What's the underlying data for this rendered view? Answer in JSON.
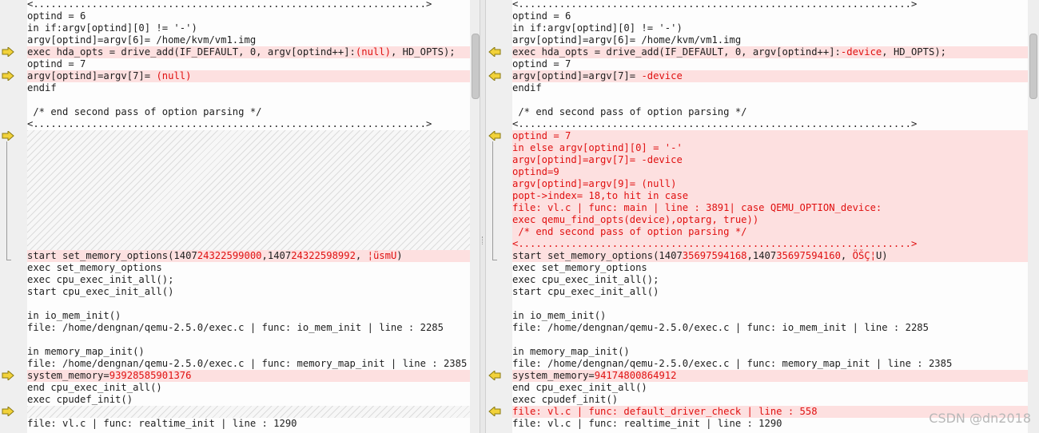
{
  "left_lines": [
    {
      "segs": [
        [
          "<...................................................................>",
          ""
        ]
      ],
      "state": "normal"
    },
    {
      "segs": [
        [
          "optind = 6",
          ""
        ]
      ],
      "state": "normal"
    },
    {
      "segs": [
        [
          "in if:argv[optind][0] != '-')",
          ""
        ]
      ],
      "state": "normal"
    },
    {
      "segs": [
        [
          "argv[optind]=argv[6]= /home/kvm/vm1.img",
          ""
        ]
      ],
      "state": "normal"
    },
    {
      "segs": [
        [
          "exec hda_opts = drive_add(IF_DEFAULT, 0, argv[optind++]:",
          ""
        ],
        [
          "(null)",
          "red"
        ],
        [
          ", HD_OPTS);",
          ""
        ]
      ],
      "state": "changed"
    },
    {
      "segs": [
        [
          "optind = 7",
          ""
        ]
      ],
      "state": "normal"
    },
    {
      "segs": [
        [
          "argv[optind]=argv[7]= ",
          ""
        ],
        [
          "(null)",
          "red"
        ]
      ],
      "state": "changed"
    },
    {
      "segs": [
        [
          "endif",
          ""
        ]
      ],
      "state": "normal"
    },
    {
      "segs": [
        [
          "",
          ""
        ]
      ],
      "state": "normal"
    },
    {
      "segs": [
        [
          " /* end second pass of option parsing */",
          ""
        ]
      ],
      "state": "normal"
    },
    {
      "segs": [
        [
          "<...................................................................>",
          ""
        ]
      ],
      "state": "normal"
    },
    {
      "segs": [],
      "state": "hatch"
    },
    {
      "segs": [],
      "state": "hatch"
    },
    {
      "segs": [],
      "state": "hatch"
    },
    {
      "segs": [],
      "state": "hatch"
    },
    {
      "segs": [],
      "state": "hatch"
    },
    {
      "segs": [],
      "state": "hatch"
    },
    {
      "segs": [],
      "state": "hatch"
    },
    {
      "segs": [],
      "state": "hatch"
    },
    {
      "segs": [],
      "state": "hatch"
    },
    {
      "segs": [],
      "state": "hatch"
    },
    {
      "segs": [
        [
          "start set_memory_options(1407",
          ""
        ],
        [
          "24322599000",
          "red"
        ],
        [
          ",1407",
          ""
        ],
        [
          "24322598992",
          "red"
        ],
        [
          ", ",
          ""
        ],
        [
          "¦üsmU",
          "red"
        ],
        [
          ")",
          ""
        ]
      ],
      "state": "changed"
    },
    {
      "segs": [
        [
          "exec set_memory_options",
          ""
        ]
      ],
      "state": "normal"
    },
    {
      "segs": [
        [
          "exec cpu_exec_init_all();",
          ""
        ]
      ],
      "state": "normal"
    },
    {
      "segs": [
        [
          "start cpu_exec_init_all()",
          ""
        ]
      ],
      "state": "normal"
    },
    {
      "segs": [
        [
          "",
          ""
        ]
      ],
      "state": "normal"
    },
    {
      "segs": [
        [
          "in io_mem_init()",
          ""
        ]
      ],
      "state": "normal"
    },
    {
      "segs": [
        [
          "file: /home/dengnan/qemu-2.5.0/exec.c | func: io_mem_init | line : 2285",
          ""
        ]
      ],
      "state": "normal"
    },
    {
      "segs": [
        [
          "",
          ""
        ]
      ],
      "state": "normal"
    },
    {
      "segs": [
        [
          "in memory_map_init()",
          ""
        ]
      ],
      "state": "normal"
    },
    {
      "segs": [
        [
          "file: /home/dengnan/qemu-2.5.0/exec.c | func: memory_map_init | line : 2385",
          ""
        ]
      ],
      "state": "normal"
    },
    {
      "segs": [
        [
          "system_memory=",
          ""
        ],
        [
          "93928585901376",
          "red"
        ]
      ],
      "state": "changed"
    },
    {
      "segs": [
        [
          "end cpu_exec_init_all()",
          ""
        ]
      ],
      "state": "normal"
    },
    {
      "segs": [
        [
          "exec cpudef_init()",
          ""
        ]
      ],
      "state": "normal"
    },
    {
      "segs": [],
      "state": "hatch"
    },
    {
      "segs": [
        [
          "file: vl.c | func: realtime_init | line : 1290",
          ""
        ]
      ],
      "state": "normal"
    }
  ],
  "right_lines": [
    {
      "segs": [
        [
          "<...................................................................>",
          ""
        ]
      ],
      "state": "normal"
    },
    {
      "segs": [
        [
          "optind = 6",
          ""
        ]
      ],
      "state": "normal"
    },
    {
      "segs": [
        [
          "in if:argv[optind][0] != '-')",
          ""
        ]
      ],
      "state": "normal"
    },
    {
      "segs": [
        [
          "argv[optind]=argv[6]= /home/kvm/vm1.img",
          ""
        ]
      ],
      "state": "normal"
    },
    {
      "segs": [
        [
          "exec hda_opts = drive_add(IF_DEFAULT, 0, argv[optind++]:",
          ""
        ],
        [
          "-device",
          "red"
        ],
        [
          ", HD_OPTS);",
          ""
        ]
      ],
      "state": "changed"
    },
    {
      "segs": [
        [
          "optind = 7",
          ""
        ]
      ],
      "state": "normal"
    },
    {
      "segs": [
        [
          "argv[optind]=argv[7]= ",
          ""
        ],
        [
          "-device",
          "red"
        ]
      ],
      "state": "changed"
    },
    {
      "segs": [
        [
          "endif",
          ""
        ]
      ],
      "state": "normal"
    },
    {
      "segs": [
        [
          "",
          ""
        ]
      ],
      "state": "normal"
    },
    {
      "segs": [
        [
          " /* end second pass of option parsing */",
          ""
        ]
      ],
      "state": "normal"
    },
    {
      "segs": [
        [
          "<...................................................................>",
          ""
        ]
      ],
      "state": "normal"
    },
    {
      "segs": [
        [
          "optind = 7",
          "red"
        ]
      ],
      "state": "changed"
    },
    {
      "segs": [
        [
          "in else argv[optind][0] = '-'",
          "red"
        ]
      ],
      "state": "changed"
    },
    {
      "segs": [
        [
          "argv[optind]=argv[7]= -device",
          "red"
        ]
      ],
      "state": "changed"
    },
    {
      "segs": [
        [
          "optind=9",
          "red"
        ]
      ],
      "state": "changed"
    },
    {
      "segs": [
        [
          "argv[optind]=argv[9]= (null)",
          "red"
        ]
      ],
      "state": "changed"
    },
    {
      "segs": [
        [
          "popt->index= 18,to hit in case",
          "red"
        ]
      ],
      "state": "changed"
    },
    {
      "segs": [
        [
          "file: vl.c | func: main | line : 3891| case QEMU_OPTION_device:",
          "red"
        ]
      ],
      "state": "changed"
    },
    {
      "segs": [
        [
          "exec qemu_find_opts(device),optarg, true))",
          "red"
        ]
      ],
      "state": "changed"
    },
    {
      "segs": [
        [
          " /* end second pass of option parsing */",
          "red"
        ]
      ],
      "state": "changed"
    },
    {
      "segs": [
        [
          "<...................................................................>",
          "red"
        ]
      ],
      "state": "changed"
    },
    {
      "segs": [
        [
          "start set_memory_options(1407",
          ""
        ],
        [
          "35697594168",
          "red"
        ],
        [
          ",1407",
          ""
        ],
        [
          "35697594160",
          "red"
        ],
        [
          ", ",
          ""
        ],
        [
          "ÖŠÇ¦",
          "red"
        ],
        [
          "U)",
          ""
        ]
      ],
      "state": "changed"
    },
    {
      "segs": [
        [
          "exec set_memory_options",
          ""
        ]
      ],
      "state": "normal"
    },
    {
      "segs": [
        [
          "exec cpu_exec_init_all();",
          ""
        ]
      ],
      "state": "normal"
    },
    {
      "segs": [
        [
          "start cpu_exec_init_all()",
          ""
        ]
      ],
      "state": "normal"
    },
    {
      "segs": [
        [
          "",
          ""
        ]
      ],
      "state": "normal"
    },
    {
      "segs": [
        [
          "in io_mem_init()",
          ""
        ]
      ],
      "state": "normal"
    },
    {
      "segs": [
        [
          "file: /home/dengnan/qemu-2.5.0/exec.c | func: io_mem_init | line : 2285",
          ""
        ]
      ],
      "state": "normal"
    },
    {
      "segs": [
        [
          "",
          ""
        ]
      ],
      "state": "normal"
    },
    {
      "segs": [
        [
          "in memory_map_init()",
          ""
        ]
      ],
      "state": "normal"
    },
    {
      "segs": [
        [
          "file: /home/dengnan/qemu-2.5.0/exec.c | func: memory_map_init | line : 2385",
          ""
        ]
      ],
      "state": "normal"
    },
    {
      "segs": [
        [
          "system_memory=",
          ""
        ],
        [
          "94174800864912",
          "red"
        ]
      ],
      "state": "changed"
    },
    {
      "segs": [
        [
          "end cpu_exec_init_all()",
          ""
        ]
      ],
      "state": "normal"
    },
    {
      "segs": [
        [
          "exec cpudef_init()",
          ""
        ]
      ],
      "state": "normal"
    },
    {
      "segs": [
        [
          "file: vl.c | func: default_driver_check | line : 558",
          "red"
        ]
      ],
      "state": "changed"
    },
    {
      "segs": [
        [
          "file: vl.c | func: realtime_init | line : 1290",
          ""
        ]
      ],
      "state": "normal"
    }
  ],
  "left_arrows": [
    4,
    6,
    11,
    31,
    34
  ],
  "right_arrows": [
    4,
    6,
    11,
    31,
    34
  ],
  "colors": {
    "change_bg": "#fde0e0",
    "change_text": "#e01010",
    "arrow_fill": "#f2d23a",
    "arrow_stroke": "#8a7a10"
  },
  "watermark": "CSDN @dn2018"
}
